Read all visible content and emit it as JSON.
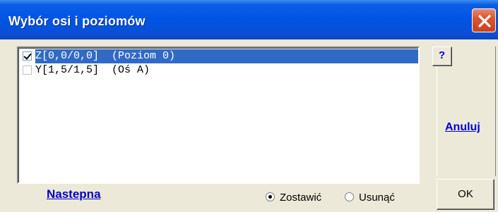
{
  "window": {
    "title": "Wybór osi i poziomów"
  },
  "list": {
    "items": [
      {
        "text": "Z[0,0/0,0]  (Poziom 0)",
        "checked": true,
        "selected": true
      },
      {
        "text": "Y[1,5/1,5]  (Oś A)",
        "checked": false,
        "selected": false
      }
    ]
  },
  "footer": {
    "next_label": "Nastepna",
    "radio_keep": "Zostawić",
    "radio_remove": "Usunąć",
    "selected_radio": "Zostawić"
  },
  "side": {
    "help_label": "?",
    "cancel_label": "Anuluj",
    "ok_label": "OK"
  },
  "colors": {
    "titlebar": "#0054e3",
    "selection": "#316ac5",
    "link": "#0000cc",
    "close": "#d8562f"
  }
}
